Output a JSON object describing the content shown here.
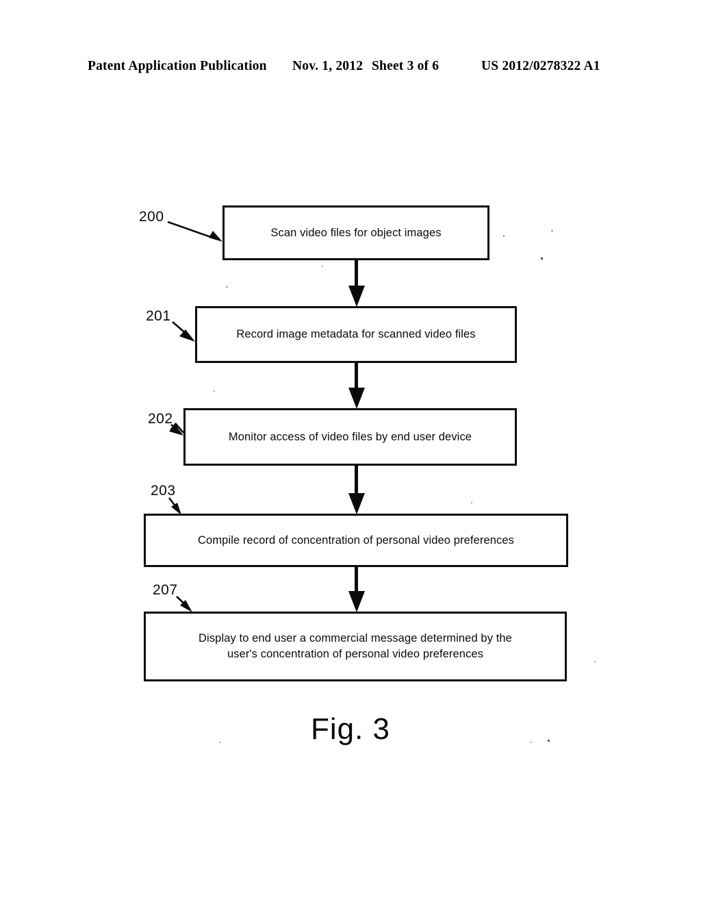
{
  "header": {
    "publication": "Patent Application Publication",
    "date": "Nov. 1, 2012",
    "sheet": "Sheet 3 of 6",
    "doc_number": "US 2012/0278322 A1"
  },
  "figure": {
    "caption": "Fig. 3",
    "type": "flowchart",
    "ink_color": "#0b0b0b",
    "page_color": "#ffffff"
  },
  "flowchart": {
    "steps": [
      {
        "ref": "200",
        "text": "Scan video files for object images",
        "lines": [
          "Scan video files for object images"
        ]
      },
      {
        "ref": "201",
        "text": "Record image metadata for scanned video files",
        "lines": [
          "Record image metadata for scanned video files"
        ]
      },
      {
        "ref": "202",
        "text": "Monitor access of video files by end user device",
        "lines": [
          "Monitor access of video files by end user device"
        ]
      },
      {
        "ref": "203",
        "text": "Compile record of concentration of personal video preferences",
        "lines": [
          "Compile record of concentration of personal video preferences"
        ]
      },
      {
        "ref": "207",
        "text": "Display to end user a commercial message determined by the user's concentration of personal video preferences",
        "lines": [
          "Display to end user a commercial message determined by the",
          "user's concentration of personal video preferences"
        ]
      }
    ],
    "connectors": [
      {
        "from": "200",
        "to": "201",
        "style": "down-arrow"
      },
      {
        "from": "201",
        "to": "202",
        "style": "down-arrow"
      },
      {
        "from": "202",
        "to": "203",
        "style": "down-arrow"
      },
      {
        "from": "203",
        "to": "207",
        "style": "down-arrow"
      }
    ]
  }
}
